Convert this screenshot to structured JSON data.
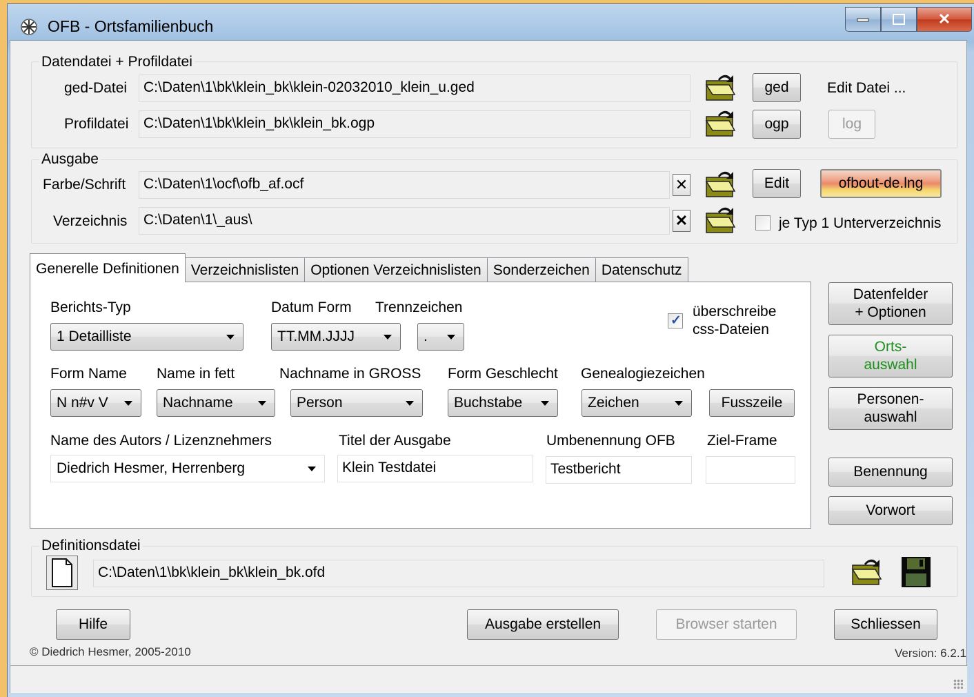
{
  "window": {
    "title": "OFB - Ortsfamilienbuch"
  },
  "datendatei": {
    "legend": "Datendatei + Profildatei",
    "ged_label": "ged-Datei",
    "ged_value": "C:\\Daten\\1\\bk\\klein_bk\\klein-02032010_klein_u.ged",
    "profil_label": "Profildatei",
    "profil_value": "C:\\Daten\\1\\bk\\klein_bk\\klein_bk.ogp",
    "ged_button": "ged",
    "ogp_button": "ogp",
    "edit_label": "Edit Datei ...",
    "log_button": "log"
  },
  "ausgabe": {
    "legend": "Ausgabe",
    "farbe_label": "Farbe/Schrift",
    "farbe_value": "C:\\Daten\\1\\ocf\\ofb_af.ocf",
    "verzeichnis_label": "Verzeichnis",
    "verzeichnis_value": "C:\\Daten\\1\\_aus\\",
    "x_glyph": "✕",
    "edit_button": "Edit",
    "lng_button": "ofbout-de.lng",
    "je_typ_label": "je Typ 1 Unterverzeichnis"
  },
  "tabs": [
    {
      "label": "Generelle Definitionen"
    },
    {
      "label": "Verzeichnislisten"
    },
    {
      "label": "Optionen Verzeichnislisten"
    },
    {
      "label": "Sonderzeichen"
    },
    {
      "label": "Datenschutz"
    }
  ],
  "general": {
    "berichts_typ_label": "Berichts-Typ",
    "berichts_typ_value": "1 Detailliste",
    "datum_form_label": "Datum Form",
    "datum_form_value": "TT.MM.JJJJ",
    "trennzeichen_label": "Trennzeichen",
    "trennzeichen_value": ".",
    "ueberschreibe_line1": "überschreibe",
    "ueberschreibe_line2": "css-Dateien",
    "form_name_label": "Form Name",
    "form_name_value": "N n#v V",
    "name_fett_label": "Name in fett",
    "name_fett_value": "Nachname",
    "nachname_gross_label": "Nachname in GROSS",
    "nachname_gross_value": "Person",
    "form_geschlecht_label": "Form Geschlecht",
    "form_geschlecht_value": "Buchstabe",
    "genealogiezeichen_label": "Genealogiezeichen",
    "genealogiezeichen_value": "Zeichen",
    "fusszeile_button": "Fusszeile",
    "autor_label": "Name des Autors / Lizenznehmers",
    "autor_value": "Diedrich Hesmer, Herrenberg",
    "titel_label": "Titel der Ausgabe",
    "titel_value": "Klein Testdatei",
    "umbenennung_label": "Umbenennung OFB",
    "umbenennung_value": "Testbericht",
    "ziel_frame_label": "Ziel-Frame",
    "ziel_frame_value": ""
  },
  "side_buttons": {
    "datenfelder_l1": "Datenfelder",
    "datenfelder_l2": "+ Optionen",
    "orts_l1": "Orts-",
    "orts_l2": "auswahl",
    "personen_l1": "Personen-",
    "personen_l2": "auswahl",
    "benennung": "Benennung",
    "vorwort": "Vorwort"
  },
  "definitionsdatei": {
    "legend": "Definitionsdatei",
    "value": "C:\\Daten\\1\\bk\\klein_bk\\klein_bk.ofd"
  },
  "bottom": {
    "hilfe": "Hilfe",
    "ausgabe_erstellen": "Ausgabe erstellen",
    "browser_starten": "Browser starten",
    "schliessen": "Schliessen",
    "copyright": "© Diedrich Hesmer, 2005-2010",
    "version": "Version: 6.2.1"
  },
  "colors": {
    "desktop": "#f3c16a",
    "green_text": "#1d8f1d",
    "folder_olive": "#8a8a14"
  }
}
